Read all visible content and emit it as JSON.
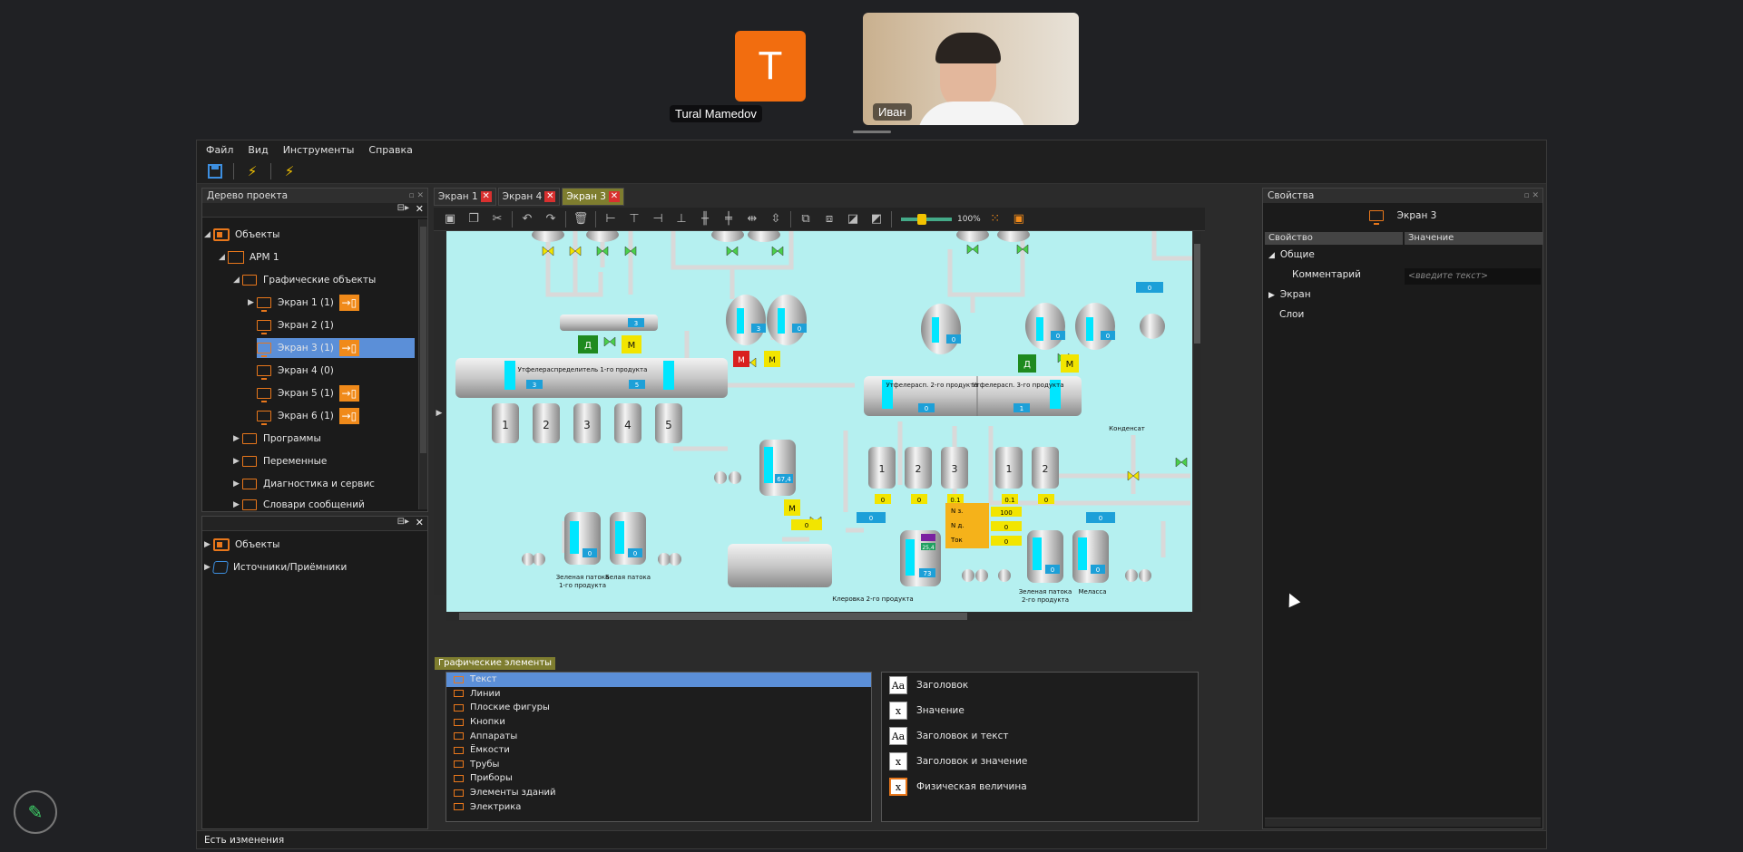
{
  "meeting": {
    "participant1_initial": "T",
    "participant1_name": "Tural Mamedov",
    "participant2_name": "Иван"
  },
  "menu": [
    "Файл",
    "Вид",
    "Инструменты",
    "Справка"
  ],
  "project_tree": {
    "title": "Дерево проекта",
    "items": [
      {
        "label": "Объекты"
      },
      {
        "label": "АРМ 1"
      },
      {
        "label": "Графические объекты"
      },
      {
        "label": "Экран 1 (1)"
      },
      {
        "label": "Экран 2 (1)"
      },
      {
        "label": "Экран 3 (1)"
      },
      {
        "label": "Экран 4 (0)"
      },
      {
        "label": "Экран 5 (1)"
      },
      {
        "label": "Экран 6 (1)"
      },
      {
        "label": "Программы"
      },
      {
        "label": "Переменные"
      },
      {
        "label": "Диагностика и сервис"
      },
      {
        "label": "Словари сообщений"
      }
    ],
    "lower_items": [
      {
        "label": "Объекты"
      },
      {
        "label": "Источники/Приёмники"
      }
    ]
  },
  "editor": {
    "tabs": [
      {
        "label": "Экран 1"
      },
      {
        "label": "Экран 4"
      },
      {
        "label": "Экран 3"
      }
    ],
    "zoom": "100%"
  },
  "mnemo": {
    "dist1_label": "Утфелераспределитель 1-го продукта",
    "dist2a_label": "Утфелерасп. 2-го продукта",
    "dist2b_label": "Утфелерасп. 3-го продукта",
    "kondensat": "Конденсат",
    "green1_a": "Зеленая патока",
    "green1_b": "1-го продукта",
    "white": "Белая патока",
    "klerovka": "Клеровка 2-го продукта",
    "green2_a": "Зеленая патока",
    "green2_b": "2-го продукта",
    "melassa": "Меласса",
    "motor": "М",
    "d": "Д",
    "centrifuges1": [
      "1",
      "2",
      "3",
      "4",
      "5"
    ],
    "centrifuges2": [
      "1",
      "2",
      "3"
    ],
    "centrifuges3": [
      "1",
      "2"
    ],
    "v_zero": "0",
    "v_three": "3",
    "v_five": "5",
    "v_one": "1",
    "v_674": "67,4",
    "v_01": "0.1",
    "v_73": "73",
    "v_254": "25,4",
    "n_label": "N з.",
    "n_val": "100",
    "nd_label": "N д.",
    "nd_val": "0",
    "tok_label": "Ток",
    "tok_val": "0"
  },
  "library": {
    "tab": "Графические элементы",
    "categories": [
      "Текст",
      "Линии",
      "Плоские фигуры",
      "Кнопки",
      "Аппараты",
      "Ёмкости",
      "Трубы",
      "Приборы",
      "Элементы зданий",
      "Электрика"
    ],
    "elements": [
      {
        "icon": "Aa",
        "label": "Заголовок"
      },
      {
        "icon": "x",
        "label": "Значение"
      },
      {
        "icon": "Aa",
        "label": "Заголовок и текст"
      },
      {
        "icon": "x",
        "label": "Заголовок и значение"
      },
      {
        "icon": "x",
        "label": "Физическая величина"
      }
    ]
  },
  "properties": {
    "title": "Свойства",
    "object": "Экран 3",
    "col_prop": "Свойство",
    "col_val": "Значение",
    "general": "Общие",
    "comment": "Комментарий",
    "comment_placeholder": "<введите текст>",
    "screen": "Экран",
    "layers": "Слои"
  },
  "status": "Есть изменения",
  "colors": {
    "accent": "#e8771b",
    "selection": "#5b8fd8",
    "canvas": "#b5f0f0",
    "active_tab": "#7e7d2f"
  }
}
